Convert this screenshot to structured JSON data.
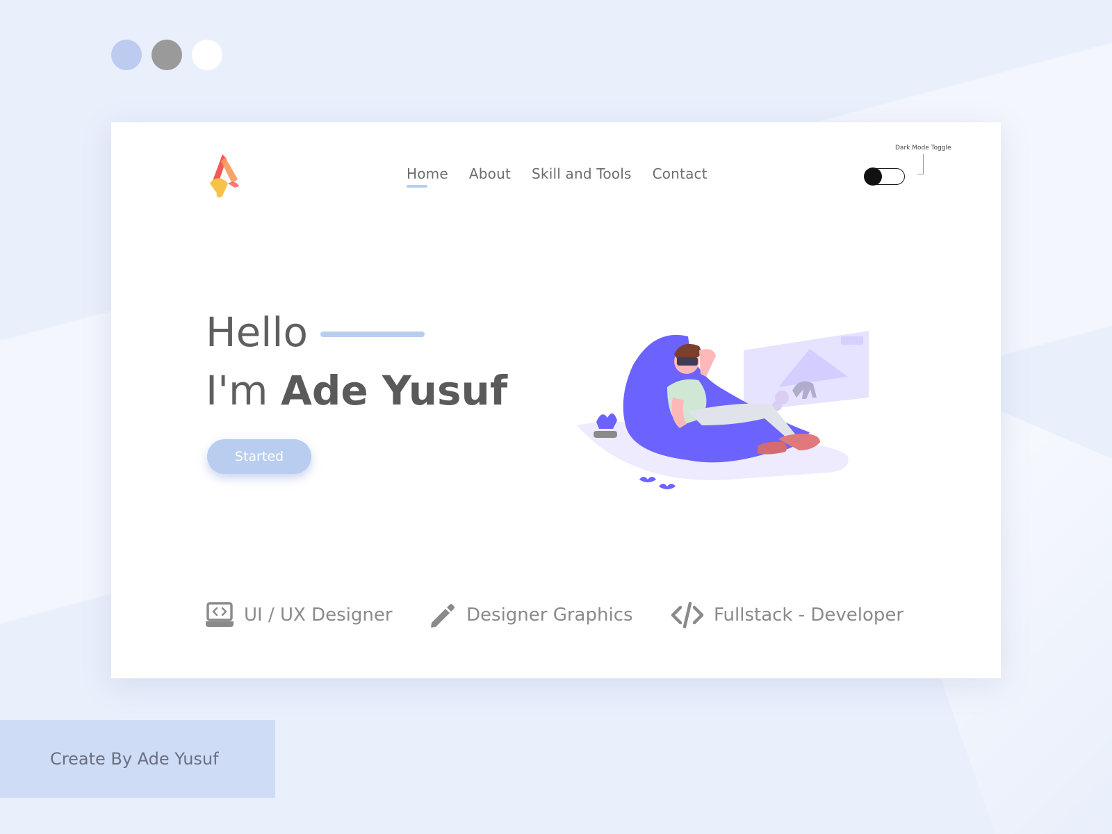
{
  "window_controls": [
    {
      "name": "light-blue",
      "color": "#bccbef"
    },
    {
      "name": "gray",
      "color": "#9a9a9a"
    },
    {
      "name": "white",
      "color": "#ffffff"
    }
  ],
  "colors": {
    "accent": "#b9cdf1",
    "text_primary": "#5f5f5f",
    "text_muted": "#8a8a8a",
    "illustration_purple": "#6c63ff",
    "credit_background": "#cfdcf5",
    "logo_red": "#f25858",
    "logo_yellow": "#f8c24a"
  },
  "header": {
    "logo_icon": "a-logo-icon",
    "nav": [
      {
        "label": "Home",
        "active": true
      },
      {
        "label": "About",
        "active": false
      },
      {
        "label": "Skill and Tools",
        "active": false
      },
      {
        "label": "Contact",
        "active": false
      }
    ],
    "dark_mode_toggle": {
      "label": "Dark Mode Toggle",
      "enabled": false
    }
  },
  "hero": {
    "greeting": "Hello",
    "intro_prefix": "I'm",
    "name": "Ade Yusuf",
    "cta_label": "Started",
    "illustration_icon": "vr-person-beanbag-illustration"
  },
  "services": [
    {
      "icon": "laptop-code-icon",
      "label": "UI / UX Designer"
    },
    {
      "icon": "pencil-icon",
      "label": "Designer Graphics"
    },
    {
      "icon": "code-icon",
      "label": "Fullstack - Developer"
    }
  ],
  "footer_credit": "Create By Ade Yusuf"
}
